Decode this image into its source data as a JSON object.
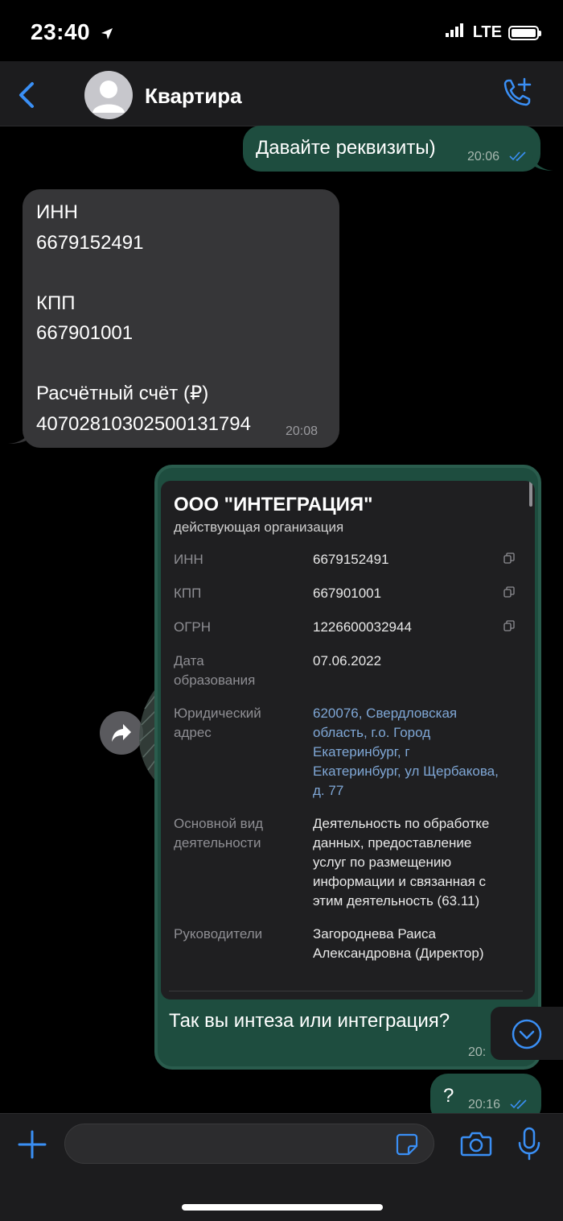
{
  "status_bar": {
    "time": "23:40",
    "network": "LTE"
  },
  "header": {
    "back_icon": "chevron-left-icon",
    "title": "Квартира",
    "call_icon": "phone-plus-icon"
  },
  "messages": [
    {
      "direction": "out",
      "text": "Давайте реквизиты)",
      "time": "20:06",
      "status": "read"
    },
    {
      "direction": "in",
      "text": "ИНН\n6679152491\n\nКПП\n667901001\n\nРасчётный счёт (₽)\n40702810302500131794",
      "time": "20:08"
    },
    {
      "direction": "out",
      "text": "Так вы интеза или интеграция?",
      "time": "20:"
    },
    {
      "direction": "out",
      "text": "?",
      "time": "20:16",
      "status": "read"
    }
  ],
  "company_card": {
    "title": "ООО \"ИНТЕГРАЦИЯ\"",
    "subtitle": "действующая организация",
    "rows": [
      {
        "label": "ИНН",
        "value": "6679152491"
      },
      {
        "label": "КПП",
        "value": "667901001"
      },
      {
        "label": "ОГРН",
        "value": "1226600032944"
      },
      {
        "label": "Дата\nобразования",
        "value": "07.06.2022"
      },
      {
        "label": "Юридический\nадрес",
        "value": "620076, Свердловская\nобласть, г.о. Город\nЕкатеринбург, г\nЕкатеринбург, ул Щербакова,\nд. 77"
      },
      {
        "label": "Основной вид\nдеятельности",
        "value": "Деятельность по обработке\nданных, предоставление\nуслуг по размещению\nинформации и связанная с\nэтим деятельность (63.11)"
      },
      {
        "label": "Руководители",
        "value": "Загороднева Раиса\nАлександровна (Директор)"
      }
    ]
  },
  "input_bar": {
    "placeholder": ""
  },
  "colors": {
    "accent": "#3a8ff5",
    "outgoing_bubble": "#1e4d3f",
    "incoming_bubble": "#363638",
    "card_border": "#2a5c4d"
  }
}
